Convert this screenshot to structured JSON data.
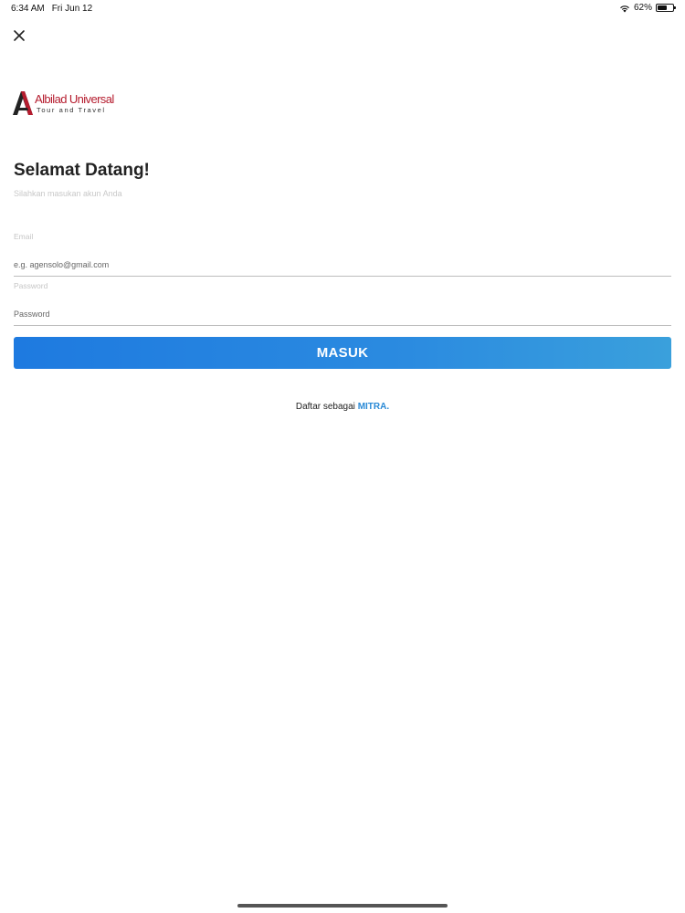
{
  "status_bar": {
    "time": "6:34 AM",
    "date": "Fri Jun 12",
    "battery_text": "62%",
    "battery_level": 0.62
  },
  "logo": {
    "name": "Albilad Universal",
    "tagline": "Tour and Travel",
    "mark_icon": "letter-a-logo",
    "brand_color": "#b51c2e"
  },
  "header": {
    "title": "Selamat Datang!",
    "subtitle": "Silahkan masukan akun Anda"
  },
  "form": {
    "email": {
      "label": "Email",
      "placeholder": "e.g. agensolo@gmail.com",
      "value": ""
    },
    "password": {
      "label": "Password",
      "placeholder": "Password",
      "value": ""
    },
    "submit_label": "MASUK",
    "accent_color": "#1e7ae0"
  },
  "register": {
    "prefix": "Daftar sebagai ",
    "link_label": "MITRA."
  }
}
